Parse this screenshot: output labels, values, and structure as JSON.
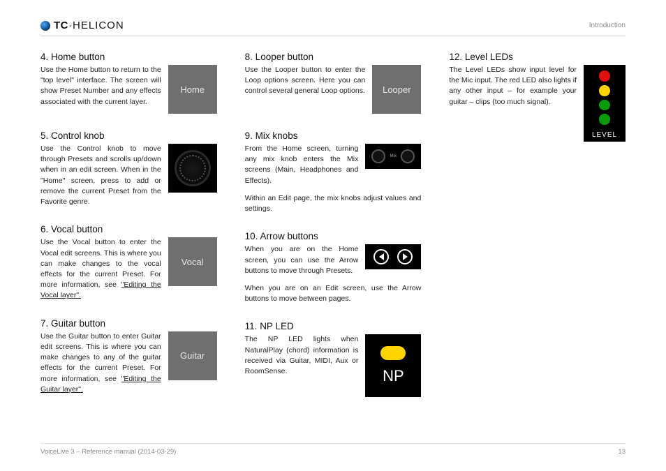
{
  "header": {
    "brand_main": "TC",
    "brand_sep": "·",
    "brand_sub": "HELICON",
    "section": "Introduction"
  },
  "col1": {
    "s4": {
      "title": "4. Home button",
      "text": "Use the Home button to return to the \"top level\" interface. The screen will show Preset Number and any effects associated with the current layer.",
      "label": "Home"
    },
    "s5": {
      "title": "5. Control knob",
      "text": "Use the Control knob to move through Presets and scrolls up/down when in an edit screen. When in the \"Home\" screen, press to add or remove the current Preset from the Favorite genre."
    },
    "s6": {
      "title": "6. Vocal button",
      "text": "Use the Vocal button to enter the Vocal edit screens. This is where you can make changes to the vocal effects for the current Preset. For more information, see ",
      "link": "\"Editing the Vocal layer\".",
      "label": "Vocal"
    },
    "s7": {
      "title": "7. Guitar button",
      "text": "Use the Guitar button to enter Guitar edit screens. This is where you can make changes to any of the guitar effects for the current Preset. For more information, see ",
      "link": "\"Editing the Guitar layer\".",
      "label": "Guitar"
    }
  },
  "col2": {
    "s8": {
      "title": "8. Looper button",
      "text": "Use the Looper button to enter the Loop options screen. Here you can control several general Loop options.",
      "label": "Looper"
    },
    "s9": {
      "title": "9. Mix knobs",
      "text": "From the Home screen, turning any mix knob enters the Mix screens (Main, Headphones and Effects).",
      "extra": "Within an Edit page, the mix knobs adjust values and settings."
    },
    "s10": {
      "title": "10. Arrow buttons",
      "text": "When you are on the Home screen, you can use the Arrow buttons to move through Presets.",
      "extra": "When you are on an Edit screen, use the Arrow buttons to move between pages."
    },
    "s11": {
      "title": "11. NP LED",
      "text": "The NP LED lights when NaturalPlay (chord) information is received via Guitar, MIDI, Aux or RoomSense.",
      "label": "NP"
    }
  },
  "col3": {
    "s12": {
      "title": "12. Level LEDs",
      "text": "The Level LEDs show input level for the Mic input. The red LED also lights if any other input – for example your guitar – clips (too much signal).",
      "label": "LEVEL"
    }
  },
  "footer": {
    "left": "VoiceLive 3 – Reference manual (2014-03-29)",
    "right": "13"
  }
}
